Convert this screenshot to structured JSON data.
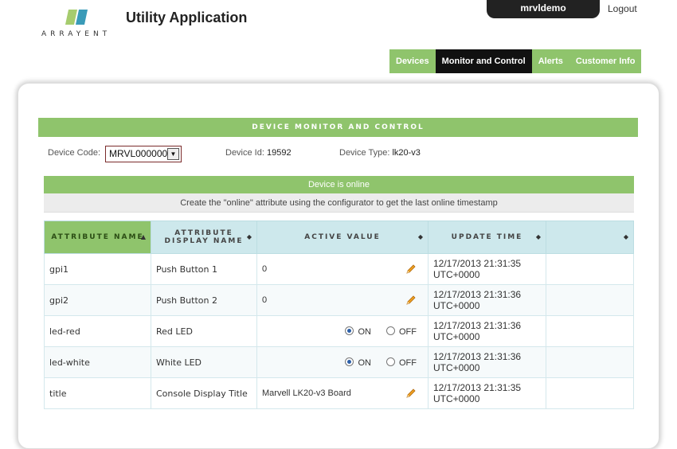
{
  "header": {
    "logo_text": "ARRAYENT",
    "app_title": "Utility Application",
    "user": "mrvldemo",
    "logout": "Logout"
  },
  "nav": {
    "items": [
      {
        "label": "Devices"
      },
      {
        "label": "Monitor and Control"
      },
      {
        "label": "Alerts"
      },
      {
        "label": "Customer Info"
      }
    ],
    "active": "Monitor and Control"
  },
  "section": {
    "title": "DEVICE MONITOR AND CONTROL"
  },
  "device": {
    "code_label": "Device Code:",
    "code_value": "MRVL000000",
    "id_label": "Device Id:",
    "id_value": "19592",
    "type_label": "Device Type:",
    "type_value": "lk20-v3"
  },
  "status": {
    "online": "Device is online",
    "note": "Create the \"online\" attribute using the configurator to get the last online timestamp"
  },
  "table": {
    "headers": [
      "ATTRIBUTE NAME",
      "ATTRIBUTE DISPLAY NAME",
      "ACTIVE VALUE",
      "UPDATE TIME",
      ""
    ],
    "rows": [
      {
        "name": "gpi1",
        "display": "Push Button 1",
        "value": "0",
        "time1": "12/17/2013 21:31:35",
        "time2": "UTC+0000"
      },
      {
        "name": "gpi2",
        "display": "Push Button 2",
        "value": "0",
        "time1": "12/17/2013 21:31:36",
        "time2": "UTC+0000"
      },
      {
        "name": "led-red",
        "display": "Red LED",
        "on": "ON",
        "off": "OFF",
        "time1": "12/17/2013 21:31:36",
        "time2": "UTC+0000"
      },
      {
        "name": "led-white",
        "display": "White LED",
        "on": "ON",
        "off": "OFF",
        "time1": "12/17/2013 21:31:36",
        "time2": "UTC+0000"
      },
      {
        "name": "title",
        "display": "Console Display Title",
        "value": "Marvell LK20-v3 Board",
        "time1": "12/17/2013 21:31:35",
        "time2": "UTC+0000"
      }
    ]
  },
  "colors": {
    "accent_green": "#8fc46c",
    "header_blue": "#cde8ec",
    "dark": "#111111"
  }
}
